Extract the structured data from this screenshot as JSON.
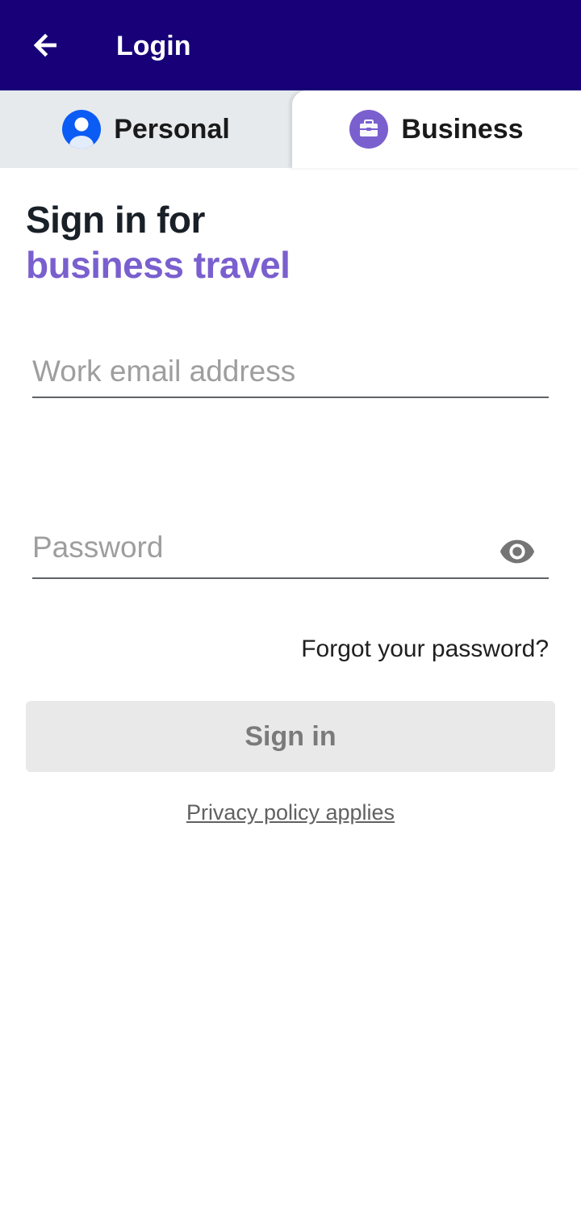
{
  "appbar": {
    "title": "Login",
    "back_icon": "arrow-left-icon",
    "background": "#170078"
  },
  "tabs": [
    {
      "label": "Personal",
      "icon": "person-icon",
      "selected": false
    },
    {
      "label": "Business",
      "icon": "briefcase-icon",
      "selected": true
    }
  ],
  "heading": {
    "line1": "Sign in for",
    "line2": "business travel",
    "accent_color": "#7a5fcf"
  },
  "form": {
    "email_placeholder": "Work email address",
    "email_value": "",
    "password_placeholder": "Password",
    "password_value": "",
    "password_toggle_icon": "eye-icon",
    "forgot_label": "Forgot your password?",
    "signin_label": "Sign in",
    "signin_enabled": false
  },
  "footer": {
    "privacy_label": "Privacy policy applies"
  }
}
